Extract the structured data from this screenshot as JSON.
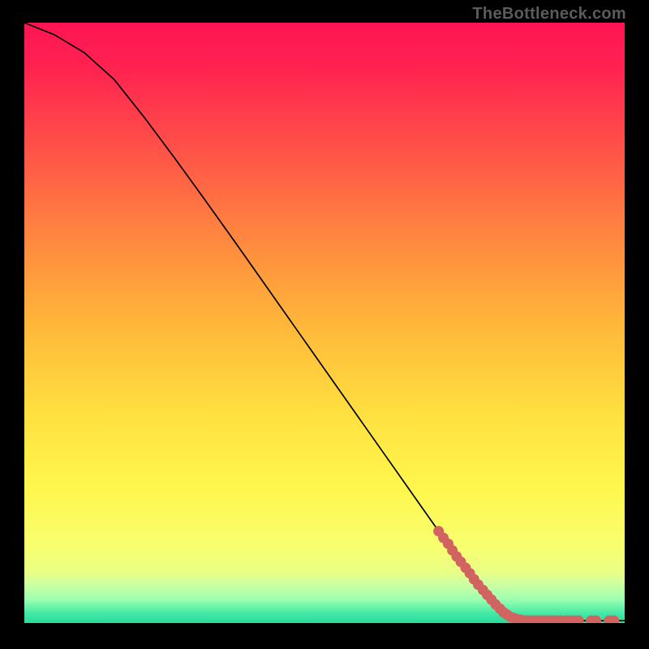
{
  "watermark": "TheBottleneck.com",
  "chart_data": {
    "type": "line",
    "title": "",
    "xlabel": "",
    "ylabel": "",
    "xlim": [
      0,
      100
    ],
    "ylim": [
      0,
      100
    ],
    "series": [
      {
        "name": "curve",
        "kind": "line",
        "x": [
          0,
          5,
          10,
          15,
          20,
          25,
          30,
          35,
          40,
          45,
          50,
          55,
          60,
          65,
          70,
          75,
          80,
          85,
          88,
          90,
          95,
          100
        ],
        "y": [
          100,
          98,
          95,
          90.5,
          84.2,
          77.5,
          70.6,
          63.6,
          56.5,
          49.4,
          42.3,
          35.2,
          28.1,
          21.0,
          13.9,
          6.8,
          1.6,
          0.5,
          0.4,
          0.4,
          0.4,
          0.4
        ]
      },
      {
        "name": "dots",
        "kind": "scatter",
        "radius": 6.5,
        "x": [
          69.0,
          69.8,
          70.6,
          71.3,
          72.0,
          72.7,
          73.5,
          74.2,
          74.9,
          75.6,
          76.4,
          77.1,
          77.8,
          78.5,
          79.2,
          79.8,
          80.4,
          81.0,
          81.6,
          82.2,
          82.8,
          83.2,
          83.8,
          84.3,
          84.8,
          85.4,
          85.9,
          86.4,
          87.0,
          87.5,
          88.0,
          88.6,
          89.4,
          90.2,
          90.8,
          91.5,
          92.3,
          94.4,
          95.2,
          97.4,
          98.2
        ],
        "y": [
          15.3,
          14.2,
          13.2,
          12.1,
          11.1,
          10.2,
          9.2,
          8.3,
          7.3,
          6.4,
          5.5,
          4.7,
          3.9,
          3.1,
          2.4,
          1.8,
          1.4,
          1.0,
          0.8,
          0.6,
          0.5,
          0.4,
          0.4,
          0.4,
          0.4,
          0.4,
          0.4,
          0.4,
          0.4,
          0.4,
          0.4,
          0.4,
          0.4,
          0.4,
          0.4,
          0.4,
          0.4,
          0.4,
          0.4,
          0.4,
          0.4
        ]
      }
    ],
    "background_gradient": {
      "stops": [
        {
          "pos": 0.0,
          "color": "#ff1453"
        },
        {
          "pos": 0.08,
          "color": "#ff2450"
        },
        {
          "pos": 0.2,
          "color": "#ff4e48"
        },
        {
          "pos": 0.35,
          "color": "#ff8440"
        },
        {
          "pos": 0.5,
          "color": "#ffb63a"
        },
        {
          "pos": 0.65,
          "color": "#ffe040"
        },
        {
          "pos": 0.78,
          "color": "#fff74e"
        },
        {
          "pos": 0.875,
          "color": "#f8ff70"
        },
        {
          "pos": 0.915,
          "color": "#e8ff86"
        },
        {
          "pos": 0.935,
          "color": "#ceffa2"
        },
        {
          "pos": 0.96,
          "color": "#9effb0"
        },
        {
          "pos": 0.985,
          "color": "#40e9a6"
        },
        {
          "pos": 1.0,
          "color": "#2bd99a"
        }
      ]
    }
  }
}
